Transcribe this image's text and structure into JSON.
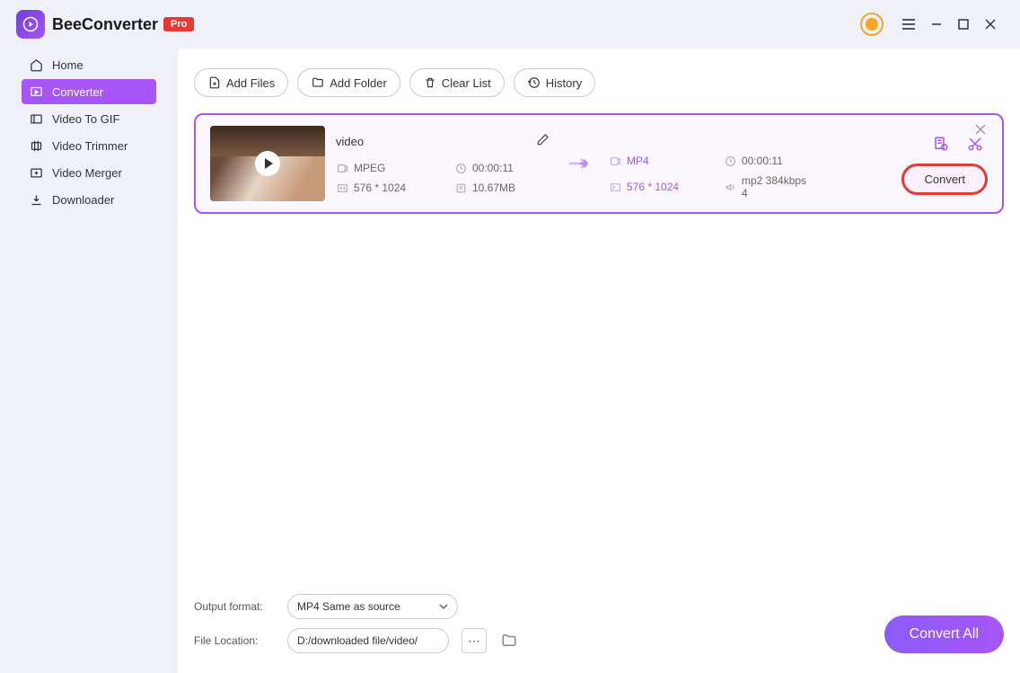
{
  "app": {
    "name": "BeeConverter",
    "badge": "Pro"
  },
  "sidebar": {
    "items": [
      {
        "label": "Home"
      },
      {
        "label": "Converter"
      },
      {
        "label": "Video To GIF"
      },
      {
        "label": "Video Trimmer"
      },
      {
        "label": "Video Merger"
      },
      {
        "label": "Downloader"
      }
    ],
    "active_index": 1
  },
  "toolbar": {
    "add_files": "Add Files",
    "add_folder": "Add Folder",
    "clear_list": "Clear List",
    "history": "History"
  },
  "file": {
    "name": "video",
    "src": {
      "format": "MPEG",
      "duration": "00:00:11",
      "resolution": "576 * 1024",
      "size": "10.67MB"
    },
    "dst": {
      "format": "MP4",
      "duration": "00:00:11",
      "resolution": "576 * 1024",
      "audio": "mp2 384kbps 4"
    },
    "convert_label": "Convert"
  },
  "footer": {
    "output_format_label": "Output format:",
    "output_format_value": "MP4 Same as source",
    "file_location_label": "File Location:",
    "file_location_value": "D:/downloaded file/video/",
    "convert_all": "Convert All"
  }
}
